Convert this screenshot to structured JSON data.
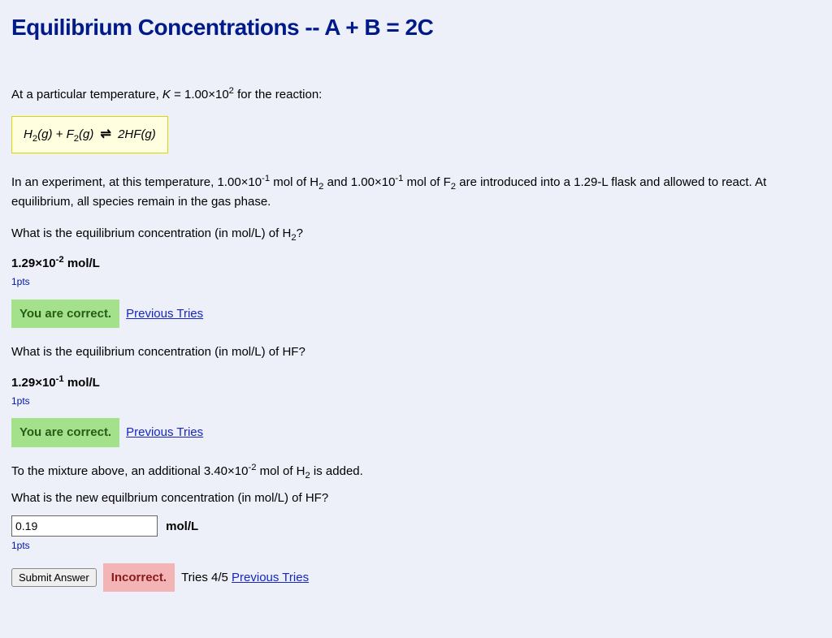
{
  "title": "Equilibrium Concentrations -- A + B = 2C",
  "intro_pre": "At a particular temperature, ",
  "intro_K": "K",
  "intro_mid": " = 1.00×10",
  "intro_exp": "2",
  "intro_post": " for the reaction:",
  "equation": {
    "h2_a": "H",
    "h2_sub": "2",
    "gas1": "(g)",
    "plus": " + ",
    "f2_a": "F",
    "f2_sub": "2",
    "gas2": "(g)",
    "arrow": "⇌",
    "hf": "  2HF",
    "gas3": "(g)"
  },
  "para2_a": "In an experiment, at this temperature, 1.00×10",
  "para2_e1": "-1",
  "para2_b": " mol of H",
  "para2_s1": "2",
  "para2_c": " and 1.00×10",
  "para2_e2": "-1",
  "para2_d": " mol of F",
  "para2_s2": "2",
  "para2_e": " are introduced into a 1.29-L flask and allowed to react. At equilibrium, all species remain in the gas phase.",
  "q1_a": "What is the equilibrium concentration (in mol/L) of H",
  "q1_sub": "2",
  "q1_b": "?",
  "a1_a": "1.29×10",
  "a1_exp": "-2",
  "a1_b": " mol/L",
  "pts_label": "1pts",
  "correct_label": "You are correct.",
  "prev_tries": "Previous Tries",
  "q2": "What is the equilibrium concentration (in mol/L) of HF?",
  "a2_a": "1.29×10",
  "a2_exp": "-1",
  "a2_b": " mol/L",
  "q3_a": "To the mixture above, an additional 3.40×10",
  "q3_e": "-2",
  "q3_b": " mol of H",
  "q3_s": "2",
  "q3_c": " is added.",
  "q3_d": "What is the new equilbrium concentration (in mol/L) of HF?",
  "input_value": "0.19",
  "input_unit": "mol/L",
  "submit_label": "Submit Answer",
  "incorrect_label": "Incorrect.",
  "tries_text": "Tries 4/5 "
}
